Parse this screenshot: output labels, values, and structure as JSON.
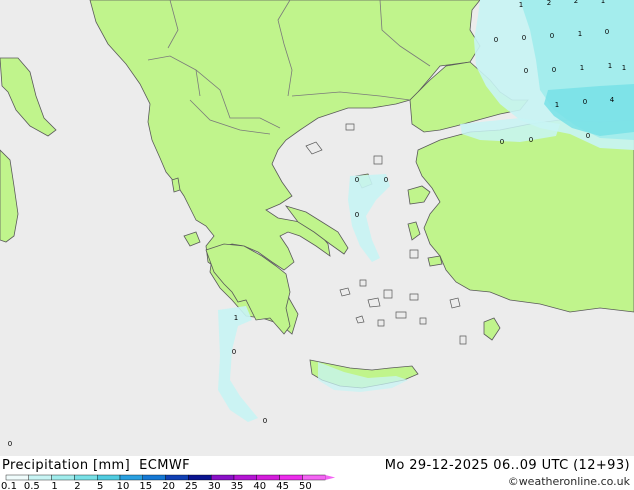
{
  "title": "Precipitation [mm]  ECMWF",
  "datetime": "Mo 29-12-2025 06..09 UTC (12+93)",
  "credit": "©weatheronline.co.uk",
  "legend": {
    "labels": [
      "0.1",
      "0.5",
      "1",
      "2",
      "5",
      "10",
      "15",
      "20",
      "25",
      "30",
      "35",
      "40",
      "45",
      "50"
    ],
    "colors": [
      "#f0fcfc",
      "#c8f4f4",
      "#a0ecec",
      "#78e0e6",
      "#50cce0",
      "#2aa0e0",
      "#1478d4",
      "#1040b4",
      "#0a1490",
      "#8a10c8",
      "#b414d4",
      "#d41cdc",
      "#ec2cec",
      "#f464f4"
    ]
  },
  "colors": {
    "sea": "#ececec",
    "land": "#c0f48c",
    "border": "#7a7a7a",
    "coast": "#5a5a5a"
  },
  "precip_values": [
    {
      "v": "1"
    },
    {
      "v": "2"
    },
    {
      "v": "2"
    },
    {
      "v": "1"
    },
    {
      "v": "0"
    },
    {
      "v": "0"
    },
    {
      "v": "0"
    },
    {
      "v": "1"
    },
    {
      "v": "0"
    },
    {
      "v": "0"
    },
    {
      "v": "0"
    },
    {
      "v": "1"
    },
    {
      "v": "1"
    },
    {
      "v": "1"
    },
    {
      "v": "1"
    },
    {
      "v": "0"
    },
    {
      "v": "4"
    },
    {
      "v": "0"
    },
    {
      "v": "0"
    },
    {
      "v": "0"
    },
    {
      "v": "0"
    },
    {
      "v": "0"
    },
    {
      "v": "0"
    },
    {
      "v": "1"
    },
    {
      "v": "0"
    },
    {
      "v": "0"
    },
    {
      "v": "0"
    }
  ]
}
